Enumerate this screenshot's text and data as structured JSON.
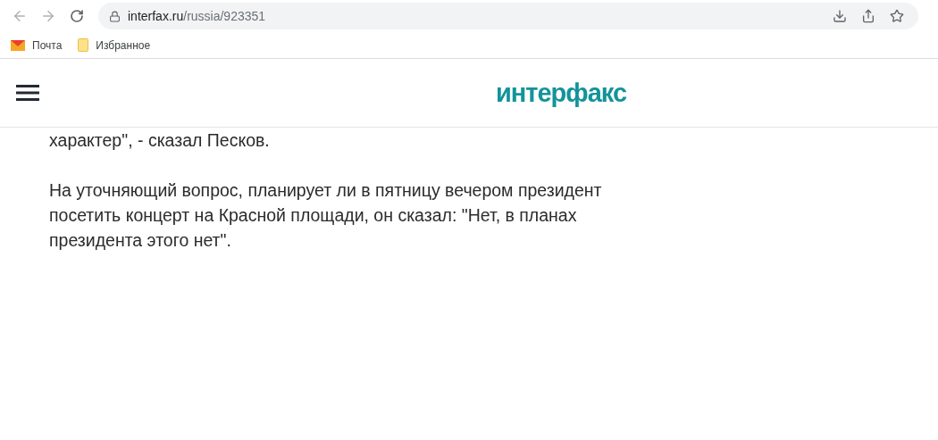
{
  "browser": {
    "url_host": "interfax.ru",
    "url_path": "/russia/923351",
    "bookmarks": [
      {
        "label": "Почта",
        "kind": "mail"
      },
      {
        "label": "Избранное",
        "kind": "folder"
      }
    ]
  },
  "site": {
    "logo": "интерфакс"
  },
  "article": {
    "paragraphs": [
      "характер\", - сказал Песков.",
      "На уточняющий вопрос, планирует ли в пятницу вечером президент посетить концерт на Красной площади, он сказал: \"Нет, в планах президента этого нет\"."
    ]
  }
}
